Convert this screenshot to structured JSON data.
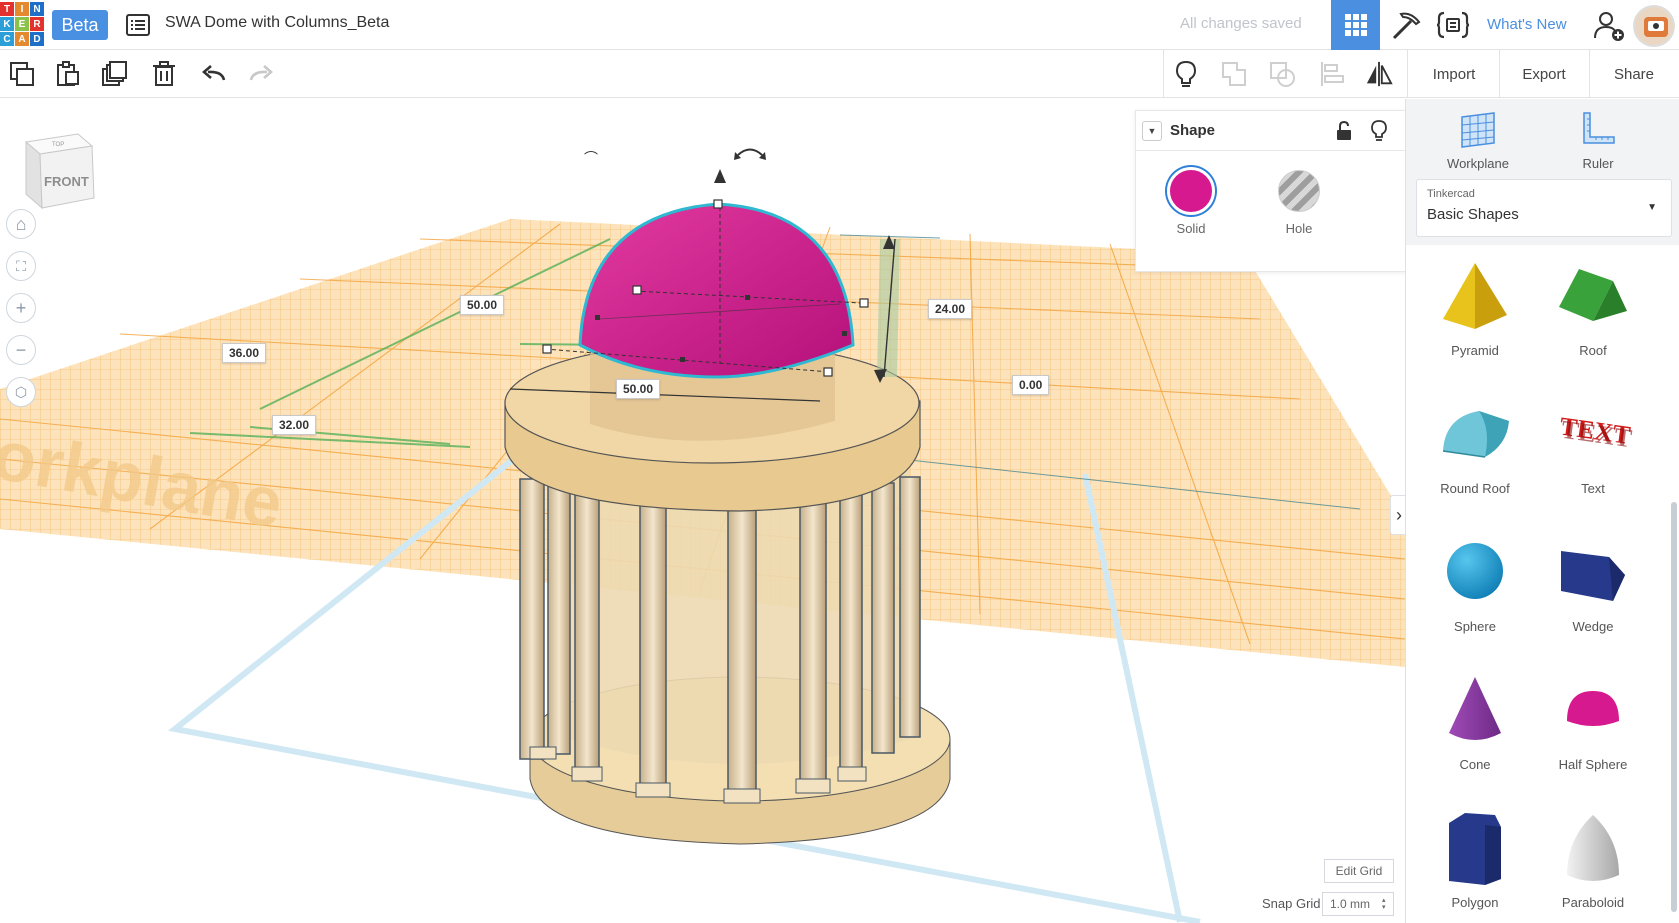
{
  "topbar": {
    "logo_letters": [
      "T",
      "I",
      "N",
      "K",
      "E",
      "R",
      "C",
      "A",
      "D"
    ],
    "beta_label": "Beta",
    "design_title": "SWA Dome with Columns_Beta",
    "save_status": "All changes saved",
    "whats_new_label": "What's New",
    "icons": [
      "design-list-icon",
      "3d-view-grid-icon",
      "bricks-pickaxe-icon",
      "codeblocks-icon",
      "add-user-icon",
      "avatar"
    ]
  },
  "toolbar": {
    "icons": [
      "copy-icon",
      "paste-icon",
      "duplicate-icon",
      "delete-icon",
      "undo-icon",
      "redo-icon",
      "lightbulb-icon",
      "group-icon",
      "ungroup-icon",
      "align-icon",
      "mirror-icon"
    ],
    "import_label": "Import",
    "export_label": "Export",
    "share_label": "Share"
  },
  "viewport": {
    "view_cube_front": "FRONT",
    "view_cube_top": "TOP",
    "workplane_text": "orkplane",
    "nav_icons": [
      "home-view-icon",
      "fit-view-icon",
      "zoom-in-icon",
      "zoom-out-icon",
      "perspective-icon"
    ],
    "dimensions": {
      "width_top": "50.00",
      "length_left": "36.00",
      "width_bottom": "50.00",
      "height": "24.00",
      "elevation": "0.00",
      "offset_x": "32.00"
    },
    "edit_grid_label": "Edit Grid",
    "snap_grid_label": "Snap Grid",
    "snap_grid_value": "1.0 mm"
  },
  "inspector": {
    "title": "Shape",
    "solid_label": "Solid",
    "hole_label": "Hole",
    "solid_color": "#d6198e"
  },
  "panel": {
    "workplane_label": "Workplane",
    "ruler_label": "Ruler",
    "library_caption": "Tinkercad",
    "library_value": "Basic Shapes",
    "shapes": [
      {
        "label": "Pyramid"
      },
      {
        "label": "Roof"
      },
      {
        "label": "Round Roof"
      },
      {
        "label": "Text"
      },
      {
        "label": "Sphere"
      },
      {
        "label": "Wedge"
      },
      {
        "label": "Cone"
      },
      {
        "label": "Half Sphere"
      },
      {
        "label": "Polygon"
      },
      {
        "label": "Paraboloid"
      }
    ]
  },
  "colors": {
    "accent_blue": "#4a8fe0",
    "grid_orange": "#f6b54d",
    "dome_magenta": "#d6198e",
    "base_tan": "#e8c98f"
  }
}
